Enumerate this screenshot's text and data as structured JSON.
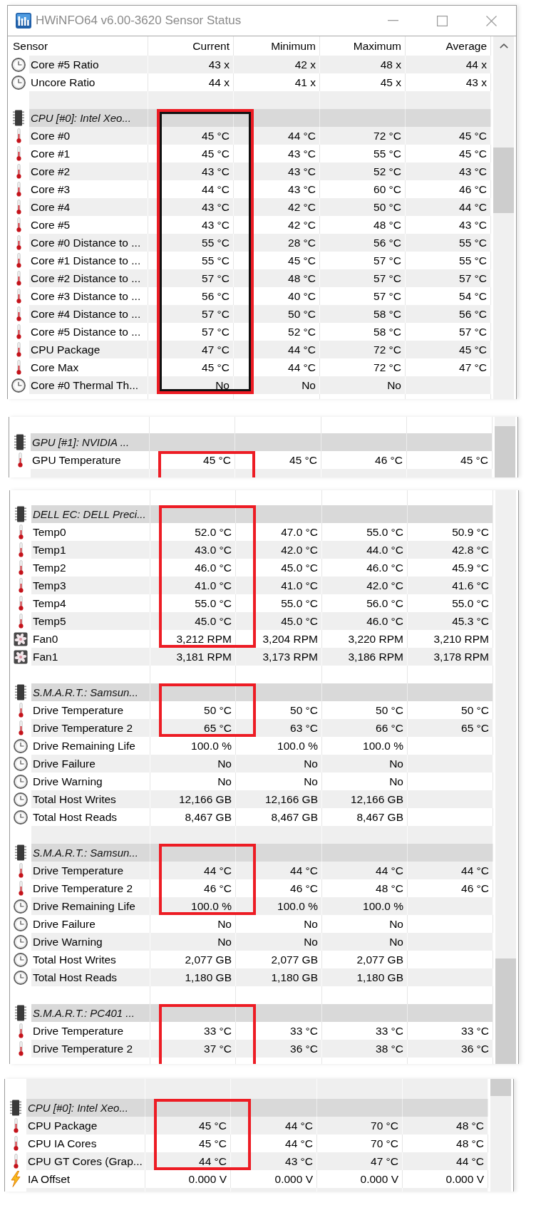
{
  "panels": [
    {
      "window": {
        "title": "HWiNFO64 v6.00-3620 Sensor Status"
      },
      "columns": [
        "Sensor",
        "Current",
        "Minimum",
        "Maximum",
        "Average"
      ],
      "sections": [
        {
          "kind": "plain",
          "rows": [
            {
              "kind": "other",
              "name": "Core #5 Ratio",
              "current": "43 x",
              "minimum": "42 x",
              "maximum": "48 x",
              "average": "44 x",
              "shaded": true
            },
            {
              "kind": "other",
              "name": "Uncore Ratio",
              "current": "44 x",
              "minimum": "41 x",
              "maximum": "45 x",
              "average": "43 x",
              "shaded": false
            },
            {
              "kind": "blank",
              "shaded": true
            }
          ]
        },
        {
          "kind": "double",
          "rows": [
            {
              "kind": "group",
              "name": "CPU [#0]: Intel Xeo..."
            },
            {
              "kind": "temperature",
              "name": "Core #0",
              "current": "45 °C",
              "minimum": "44 °C",
              "maximum": "72 °C",
              "average": "45 °C",
              "shaded": true
            },
            {
              "kind": "temperature",
              "name": "Core #1",
              "current": "45 °C",
              "minimum": "43 °C",
              "maximum": "55 °C",
              "average": "45 °C",
              "shaded": false
            },
            {
              "kind": "temperature",
              "name": "Core #2",
              "current": "43 °C",
              "minimum": "43 °C",
              "maximum": "52 °C",
              "average": "43 °C",
              "shaded": true
            },
            {
              "kind": "temperature",
              "name": "Core #3",
              "current": "44 °C",
              "minimum": "43 °C",
              "maximum": "60 °C",
              "average": "46 °C",
              "shaded": false
            },
            {
              "kind": "temperature",
              "name": "Core #4",
              "current": "43 °C",
              "minimum": "42 °C",
              "maximum": "50 °C",
              "average": "44 °C",
              "shaded": true
            },
            {
              "kind": "temperature",
              "name": "Core #5",
              "current": "43 °C",
              "minimum": "42 °C",
              "maximum": "48 °C",
              "average": "43 °C",
              "shaded": false
            },
            {
              "kind": "temperature",
              "name": "Core #0 Distance to ...",
              "current": "55 °C",
              "minimum": "28 °C",
              "maximum": "56 °C",
              "average": "55 °C",
              "shaded": true
            },
            {
              "kind": "temperature",
              "name": "Core #1 Distance to ...",
              "current": "55 °C",
              "minimum": "45 °C",
              "maximum": "57 °C",
              "average": "55 °C",
              "shaded": false
            },
            {
              "kind": "temperature",
              "name": "Core #2 Distance to ...",
              "current": "57 °C",
              "minimum": "48 °C",
              "maximum": "57 °C",
              "average": "57 °C",
              "shaded": true
            },
            {
              "kind": "temperature",
              "name": "Core #3 Distance to ...",
              "current": "56 °C",
              "minimum": "40 °C",
              "maximum": "57 °C",
              "average": "54 °C",
              "shaded": false
            },
            {
              "kind": "temperature",
              "name": "Core #4 Distance to ...",
              "current": "57 °C",
              "minimum": "50 °C",
              "maximum": "58 °C",
              "average": "56 °C",
              "shaded": true
            },
            {
              "kind": "temperature",
              "name": "Core #5 Distance to ...",
              "current": "57 °C",
              "minimum": "52 °C",
              "maximum": "58 °C",
              "average": "57 °C",
              "shaded": false
            },
            {
              "kind": "temperature",
              "name": "CPU Package",
              "current": "47 °C",
              "minimum": "44 °C",
              "maximum": "72 °C",
              "average": "45 °C",
              "shaded": true
            },
            {
              "kind": "temperature",
              "name": "Core Max",
              "current": "45 °C",
              "minimum": "44 °C",
              "maximum": "72 °C",
              "average": "47 °C",
              "shaded": false
            },
            {
              "kind": "other",
              "name": "Core #0 Thermal Th...",
              "current": "No",
              "minimum": "No",
              "maximum": "No",
              "shaded": true
            }
          ]
        },
        {
          "kind": "plain",
          "rows": [
            {
              "kind": "cut",
              "shaded": false
            }
          ]
        }
      ]
    },
    {
      "sections": [
        {
          "kind": "plain",
          "rows": [
            {
              "kind": "cut",
              "shaded": false
            },
            {
              "kind": "group",
              "name": "GPU [#1]: NVIDIA ..."
            }
          ]
        },
        {
          "kind": "boxed",
          "rows": [
            {
              "kind": "temperature",
              "name": "GPU Temperature",
              "current": "45 °C",
              "minimum": "45 °C",
              "maximum": "46 °C",
              "average": "45 °C",
              "shaded": false
            },
            {
              "kind": "cut",
              "shaded": true
            }
          ]
        }
      ]
    },
    {
      "sections": [
        {
          "kind": "plain",
          "rows": [
            {
              "kind": "cut",
              "shaded": false
            }
          ]
        },
        {
          "kind": "boxed",
          "rows": [
            {
              "kind": "group",
              "name": "DELL EC: DELL Preci..."
            },
            {
              "kind": "temperature",
              "name": "Temp0",
              "current": "52.0 °C",
              "minimum": "47.0 °C",
              "maximum": "55.0 °C",
              "average": "50.9 °C",
              "shaded": false
            },
            {
              "kind": "temperature",
              "name": "Temp1",
              "current": "43.0 °C",
              "minimum": "42.0 °C",
              "maximum": "44.0 °C",
              "average": "42.8 °C",
              "shaded": true
            },
            {
              "kind": "temperature",
              "name": "Temp2",
              "current": "46.0 °C",
              "minimum": "45.0 °C",
              "maximum": "46.0 °C",
              "average": "45.9 °C",
              "shaded": false
            },
            {
              "kind": "temperature",
              "name": "Temp3",
              "current": "41.0 °C",
              "minimum": "41.0 °C",
              "maximum": "42.0 °C",
              "average": "41.6 °C",
              "shaded": true
            },
            {
              "kind": "temperature",
              "name": "Temp4",
              "current": "55.0 °C",
              "minimum": "55.0 °C",
              "maximum": "56.0 °C",
              "average": "55.0 °C",
              "shaded": false
            },
            {
              "kind": "temperature",
              "name": "Temp5",
              "current": "45.0 °C",
              "minimum": "45.0 °C",
              "maximum": "46.0 °C",
              "average": "45.3 °C",
              "shaded": true
            },
            {
              "kind": "fan",
              "name": "Fan0",
              "current": "3,212 RPM",
              "minimum": "3,204 RPM",
              "maximum": "3,220 RPM",
              "average": "3,210 RPM",
              "shaded": false
            }
          ]
        },
        {
          "kind": "plain",
          "rows": [
            {
              "kind": "fan",
              "name": "Fan1",
              "current": "3,181 RPM",
              "minimum": "3,173 RPM",
              "maximum": "3,186 RPM",
              "average": "3,178 RPM",
              "shaded": true
            },
            {
              "kind": "blank",
              "shaded": false
            }
          ]
        },
        {
          "kind": "boxed",
          "rows": [
            {
              "kind": "group",
              "name": "S.M.A.R.T.: Samsun..."
            },
            {
              "kind": "temperature",
              "name": "Drive Temperature",
              "current": "50 °C",
              "minimum": "50 °C",
              "maximum": "50 °C",
              "average": "50 °C",
              "shaded": false
            },
            {
              "kind": "temperature",
              "name": "Drive Temperature 2",
              "current": "65 °C",
              "minimum": "63 °C",
              "maximum": "66 °C",
              "average": "65 °C",
              "shaded": true
            }
          ]
        },
        {
          "kind": "plain",
          "rows": [
            {
              "kind": "other",
              "name": "Drive Remaining Life",
              "current": "100.0 %",
              "minimum": "100.0 %",
              "maximum": "100.0 %",
              "shaded": false
            },
            {
              "kind": "other",
              "name": "Drive Failure",
              "current": "No",
              "minimum": "No",
              "maximum": "No",
              "shaded": true
            },
            {
              "kind": "other",
              "name": "Drive Warning",
              "current": "No",
              "minimum": "No",
              "maximum": "No",
              "shaded": false
            },
            {
              "kind": "other",
              "name": "Total Host Writes",
              "current": "12,166 GB",
              "minimum": "12,166 GB",
              "maximum": "12,166 GB",
              "shaded": true
            },
            {
              "kind": "other",
              "name": "Total Host Reads",
              "current": "8,467 GB",
              "minimum": "8,467 GB",
              "maximum": "8,467 GB",
              "shaded": false
            },
            {
              "kind": "blank",
              "shaded": true
            }
          ]
        },
        {
          "kind": "boxed",
          "rows": [
            {
              "kind": "group",
              "name": "S.M.A.R.T.: Samsun..."
            },
            {
              "kind": "temperature",
              "name": "Drive Temperature",
              "current": "44 °C",
              "minimum": "44 °C",
              "maximum": "44 °C",
              "average": "44 °C",
              "shaded": true
            },
            {
              "kind": "temperature",
              "name": "Drive Temperature 2",
              "current": "46 °C",
              "minimum": "46 °C",
              "maximum": "48 °C",
              "average": "46 °C",
              "shaded": false
            },
            {
              "kind": "other",
              "name": "Drive Remaining Life",
              "current": "100.0 %",
              "minimum": "100.0 %",
              "maximum": "100.0 %",
              "shaded": true
            }
          ]
        },
        {
          "kind": "plain",
          "rows": [
            {
              "kind": "other",
              "name": "Drive Failure",
              "current": "No",
              "minimum": "No",
              "maximum": "No",
              "shaded": false
            },
            {
              "kind": "other",
              "name": "Drive Warning",
              "current": "No",
              "minimum": "No",
              "maximum": "No",
              "shaded": true
            },
            {
              "kind": "other",
              "name": "Total Host Writes",
              "current": "2,077 GB",
              "minimum": "2,077 GB",
              "maximum": "2,077 GB",
              "shaded": false
            },
            {
              "kind": "other",
              "name": "Total Host Reads",
              "current": "1,180 GB",
              "minimum": "1,180 GB",
              "maximum": "1,180 GB",
              "shaded": true
            },
            {
              "kind": "blank",
              "shaded": false
            }
          ]
        },
        {
          "kind": "boxed",
          "rows": [
            {
              "kind": "group",
              "name": "S.M.A.R.T.: PC401 ..."
            },
            {
              "kind": "temperature",
              "name": "Drive Temperature",
              "current": "33 °C",
              "minimum": "33 °C",
              "maximum": "33 °C",
              "average": "33 °C",
              "shaded": false
            },
            {
              "kind": "temperature",
              "name": "Drive Temperature 2",
              "current": "37 °C",
              "minimum": "36 °C",
              "maximum": "38 °C",
              "average": "36 °C",
              "shaded": true
            },
            {
              "kind": "cut",
              "shaded": false
            }
          ]
        }
      ]
    },
    {
      "sections": [
        {
          "kind": "plain",
          "rows": [
            {
              "kind": "cut",
              "shaded": true
            }
          ]
        },
        {
          "kind": "boxed",
          "rows": [
            {
              "kind": "group",
              "name": "CPU [#0]: Intel Xeo..."
            },
            {
              "kind": "temperature",
              "name": "CPU Package",
              "current": "45 °C",
              "minimum": "44 °C",
              "maximum": "70 °C",
              "average": "48 °C",
              "shaded": true
            },
            {
              "kind": "temperature",
              "name": "CPU IA Cores",
              "current": "45 °C",
              "minimum": "44 °C",
              "maximum": "70 °C",
              "average": "48 °C",
              "shaded": false
            },
            {
              "kind": "temperature",
              "name": "CPU GT Cores (Grap...",
              "current": "44 °C",
              "minimum": "43 °C",
              "maximum": "47 °C",
              "average": "44 °C",
              "shaded": true
            }
          ]
        },
        {
          "kind": "plain",
          "rows": [
            {
              "kind": "voltage",
              "name": "IA Offset",
              "current": "0.000 V",
              "minimum": "0.000 V",
              "maximum": "0.000 V",
              "average": "0.000 V",
              "shaded": false
            },
            {
              "kind": "cut",
              "shaded": true
            }
          ]
        }
      ]
    }
  ]
}
